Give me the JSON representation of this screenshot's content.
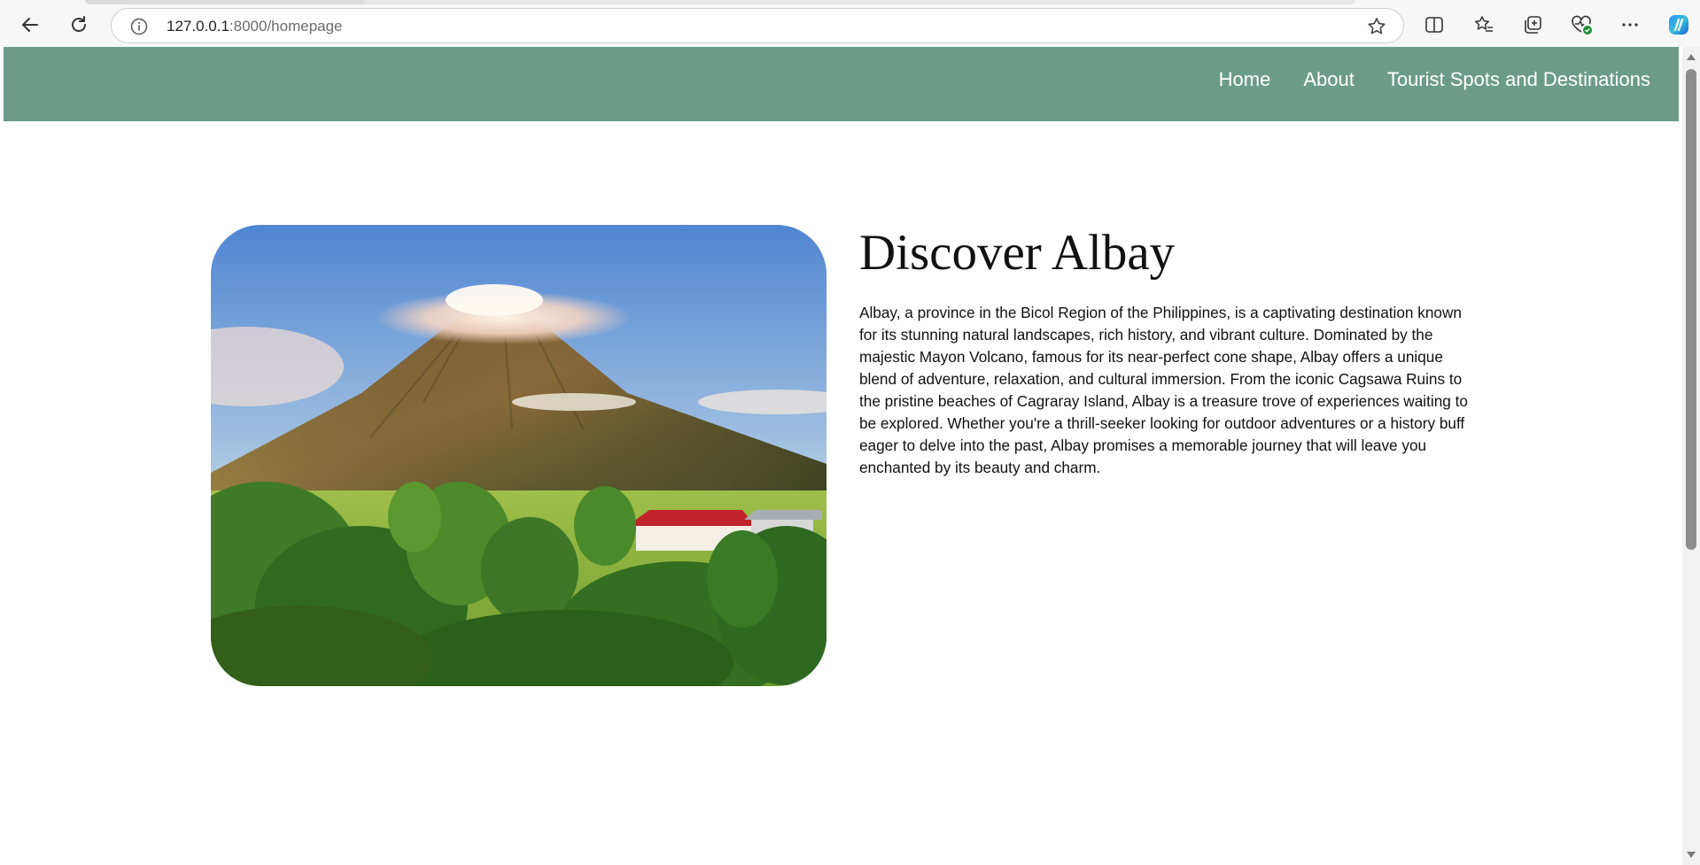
{
  "browser": {
    "url_host": "127.0.0.1",
    "url_path": ":8000/homepage",
    "icons": [
      "back-arrow-icon",
      "refresh-icon",
      "info-icon",
      "favorite-star-icon",
      "split-screen-icon",
      "favorites-icon",
      "collections-icon",
      "browser-essentials-icon",
      "more-icon",
      "copilot-icon"
    ]
  },
  "header": {
    "background_color": "#6c9c88",
    "nav": [
      {
        "label": "Home"
      },
      {
        "label": "About"
      },
      {
        "label": "Tourist Spots and Destinations"
      }
    ]
  },
  "hero": {
    "title": "Discover Albay",
    "description": "Albay, a province in the Bicol Region of the Philippines, is a captivating destination known for its stunning natural landscapes, rich history, and vibrant culture. Dominated by the majestic Mayon Volcano, famous for its near-perfect cone shape, Albay offers a unique blend of adventure, relaxation, and cultural immersion. From the iconic Cagsawa Ruins to the pristine beaches of Cagraray Island, Albay is a treasure trove of experiences waiting to be explored. Whether you're a thrill-seeker looking for outdoor adventures or a history buff eager to delve into the past, Albay promises a memorable journey that will leave you enchanted by its beauty and charm."
  }
}
